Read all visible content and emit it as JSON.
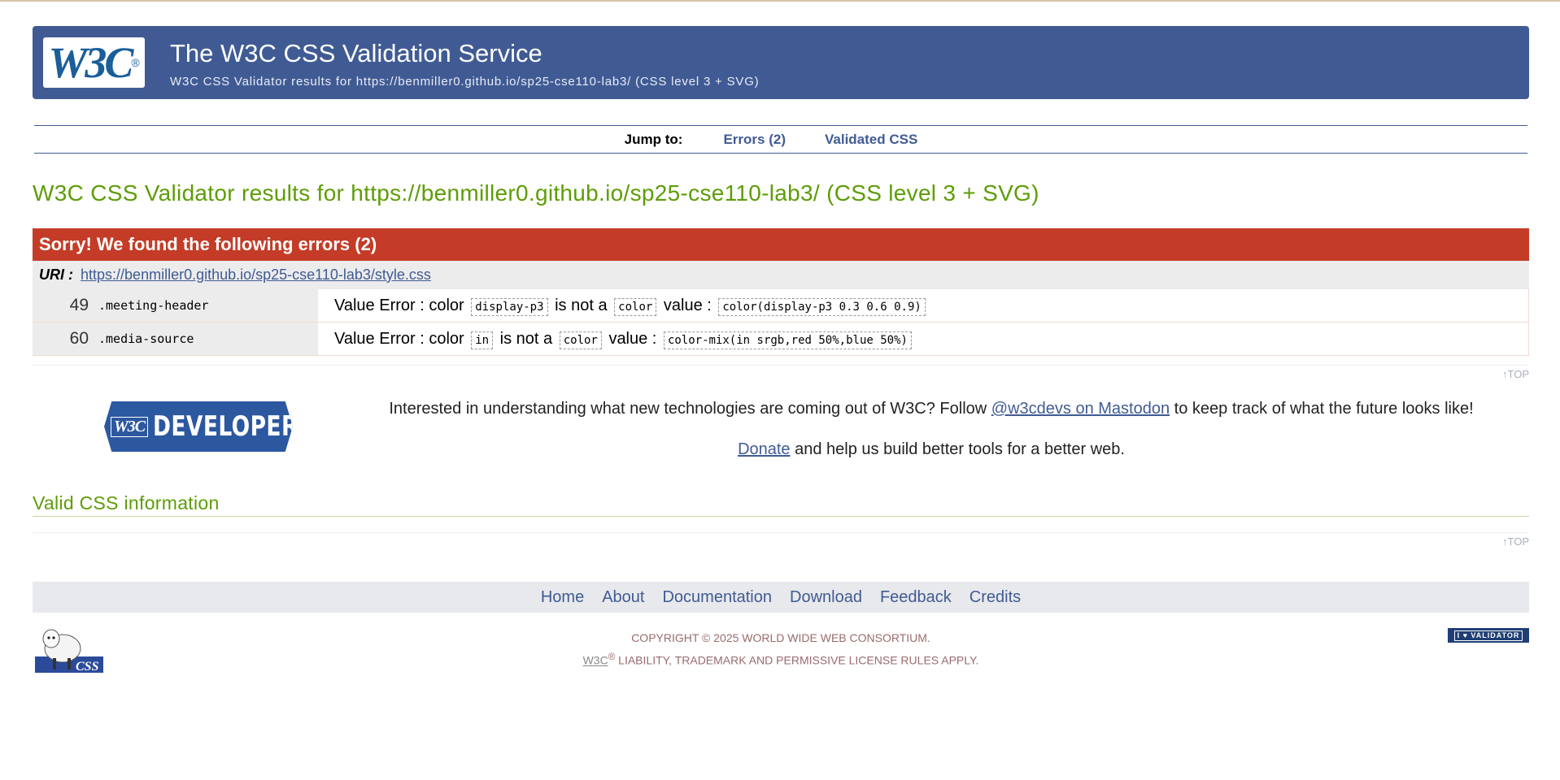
{
  "banner": {
    "logo_text": "W3C",
    "title": "The W3C CSS Validation Service",
    "subtitle": "W3C CSS Validator results for https://benmiller0.github.io/sp25-cse110-lab3/ (CSS level 3 + SVG)"
  },
  "jump": {
    "label": "Jump to:",
    "errors_link": "Errors (2)",
    "validated_link": "Validated CSS"
  },
  "results_title": "W3C CSS Validator results for https://benmiller0.github.io/sp25-cse110-lab3/ (CSS level 3 + SVG)",
  "errors": {
    "heading": "Sorry! We found the following errors (2)",
    "uri_label": "URI :",
    "uri": "https://benmiller0.github.io/sp25-cse110-lab3/style.css",
    "rows": [
      {
        "line": "49",
        "context": ".meeting-header",
        "msg_a": "Value Error : color",
        "code_a": "display-p3",
        "msg_b": "is not a",
        "code_b": "color",
        "msg_c": "value :",
        "code_c": "color(display-p3 0.3 0.6 0.9)"
      },
      {
        "line": "60",
        "context": ".media-source",
        "msg_a": "Value Error : color",
        "code_a": "in",
        "msg_b": "is not a",
        "code_b": "color",
        "msg_c": "value :",
        "code_c": "color-mix(in srgb,red 50%,blue 50%)"
      }
    ]
  },
  "top_link": "↑TOP",
  "developers": {
    "logo_w3": "W3C",
    "logo_text": "DEVELOPERS",
    "text_before": "Interested in understanding what new technologies are coming out of W3C? Follow",
    "mastodon_link": "@w3cdevs on Mastodon",
    "text_after": "to keep track of what the future looks like!",
    "donate_link": "Donate",
    "donate_text": "and help us build better tools for a better web."
  },
  "valid_title": "Valid CSS information",
  "footer": {
    "nav": [
      "Home",
      "About",
      "Documentation",
      "Download",
      "Feedback",
      "Credits"
    ],
    "copyright_line1": "COPYRIGHT © 2025 WORLD WIDE WEB CONSORTIUM.",
    "w3c": "W3C",
    "reg": "®",
    "copyright_line2": "LIABILITY, TRADEMARK AND PERMISSIVE LICENSE RULES APPLY.",
    "badge": "I ♥ VALIDATOR",
    "sheep_label": "CSS"
  }
}
